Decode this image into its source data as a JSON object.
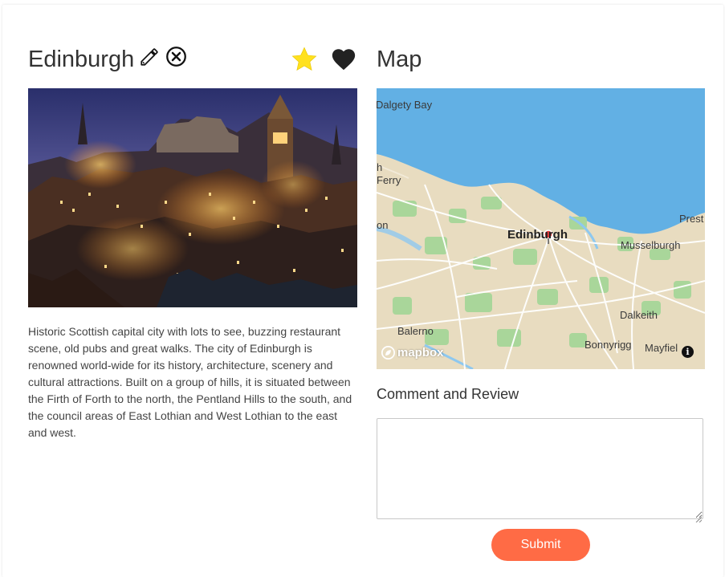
{
  "place": {
    "title": "Edinburgh",
    "description": "Historic Scottish capital city with lots to see, buzzing restaurant scene, old pubs and great walks. The city of Edinburgh is renowned world-wide for its history, architecture, scenery and cultural attractions. Built on a group of hills, it is situated between the Firth of Forth to the north, the Pentland Hills to the south, and the council areas of East Lothian and West Lothian to the east and west."
  },
  "icons": {
    "edit": "pencil-icon",
    "delete": "circle-x-icon",
    "favorite": "star-icon",
    "like": "heart-icon",
    "favorite_color": "#ffe11f",
    "like_color": "#222222"
  },
  "map": {
    "title": "Map",
    "labels": {
      "dalgety_bay": "Dalgety Bay",
      "ferry_h": "h",
      "ferry": "Ferry",
      "on": "on",
      "edinburgh": "Edinburgh",
      "prest": "Prest",
      "musselburgh": "Musselburgh",
      "dalkeith": "Dalkeith",
      "balerno": "Balerno",
      "bonnyrigg": "Bonnyrigg",
      "mayfield": "Mayfiel"
    },
    "attribution": "mapbox",
    "sea_color": "#62b0e4",
    "land_color": "#e8dcc0",
    "park_color": "#a9d69a"
  },
  "review": {
    "label": "Comment and Review",
    "value": "",
    "submit_label": "Submit",
    "submit_color": "#ff6b45"
  }
}
